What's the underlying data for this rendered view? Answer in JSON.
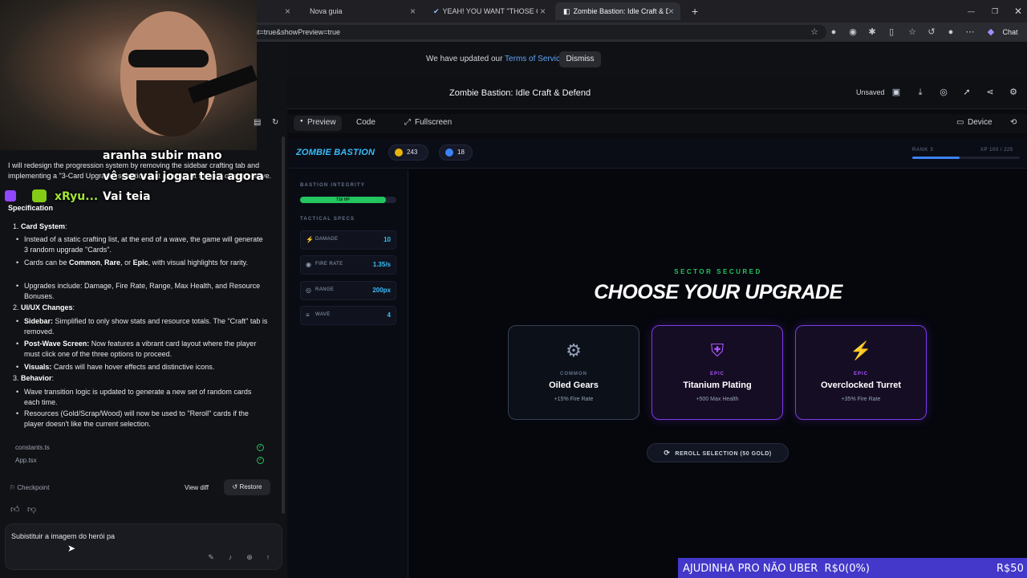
{
  "browser": {
    "tabs": [
      {
        "label": "",
        "close": "×"
      },
      {
        "label": "Nova guia",
        "close": "×"
      },
      {
        "label": "YEAH! YOU WANT \"THOSE GAMES\"",
        "close": "×"
      },
      {
        "label": "Zombie Bastion: Idle Craft & D | G",
        "close": "×"
      }
    ],
    "new_tab": "+",
    "url": "nt=true&showPreview=true",
    "chat_label": "Chat"
  },
  "notice": {
    "text": "We have updated our ",
    "link": "Terms of Service",
    "dismiss": "Dismiss"
  },
  "project": {
    "title": "Zombie Bastion: Idle Craft & Defend",
    "unsaved": "Unsaved"
  },
  "stream": {
    "captions": [
      "aranha subir mano",
      "vê se vai jogar teia agora",
      "xRyu...",
      "Vai teia"
    ]
  },
  "chat": {
    "intro": "I will redesign the progression system by removing the sidebar crafting tab and implementing a \"3-Card Upgrade\" selection that appears at the end of every wave.",
    "spec_heading": "Specification",
    "sections": [
      {
        "num": "1.",
        "title": "Card System",
        "bullets": [
          "Instead of a static crafting list, at the end of a wave, the game will generate 3 random upgrade \"Cards\".",
          "Cards can be Common, Rare, or Epic, with visual highlights for rarity.",
          "Upgrades include: Damage, Fire Rate, Range, Max Health, and Resource Bonuses."
        ]
      },
      {
        "num": "2.",
        "title": "UI/UX Changes",
        "bullets": [
          "Sidebar: Simplified to only show stats and resource totals. The \"Craft\" tab is removed.",
          "Post-Wave Screen: Now features a vibrant card layout where the player must click one of the three options to proceed.",
          "Visuals: Cards will have hover effects and distinctive icons."
        ]
      },
      {
        "num": "3.",
        "title": "Behavior",
        "bullets": [
          "Wave transition logic is updated to generate a new set of random cards each time.",
          "Resources (Gold/Scrap/Wood) will now be used to \"Reroll\" cards if the player doesn't like the current selection."
        ]
      }
    ],
    "files": [
      "constants.ts",
      "App.tsx"
    ],
    "checkpoint": "Checkpoint",
    "view_diff": "View diff",
    "restore": "Restore",
    "input_value": "Subistituir a imagem do herói pa"
  },
  "preview": {
    "tabs": [
      "Preview",
      "Code",
      "Fullscreen"
    ],
    "device": "Device"
  },
  "game": {
    "logo": "ZOMBIE BASTION",
    "gold": "243",
    "gems": "18",
    "rank": "RANK 3",
    "xp": "XP 100 / 225",
    "xp_fraction": 0.44,
    "integrity_label": "BASTION INTEGRITY",
    "hp_text": "716 HP",
    "hp_fraction": 0.89,
    "specs_label": "TACTICAL SPECS",
    "stats": [
      {
        "icon": "⚡",
        "label": "DAMAGE",
        "value": "10"
      },
      {
        "icon": "◉",
        "label": "FIRE RATE",
        "value": "1.35/s"
      },
      {
        "icon": "◎",
        "label": "RANGE",
        "value": "200px"
      },
      {
        "icon": "≡",
        "label": "WAVE",
        "value": "4"
      }
    ],
    "secured": "SECTOR SECURED",
    "choose": "CHOOSE YOUR UPGRADE",
    "cards": [
      {
        "icon": "⚙",
        "rarity": "COMMON",
        "name": "Oiled Gears",
        "desc": "+15% Fire Rate",
        "icon_color": "#94a3b8",
        "rarity_color": "#64748b"
      },
      {
        "icon": "⛨",
        "rarity": "EPIC",
        "name": "Titanium Plating",
        "desc": "+500 Max Health",
        "icon_color": "#a855f7",
        "rarity_color": "#a855f7"
      },
      {
        "icon": "⚡",
        "rarity": "EPIC",
        "name": "Overclocked Turret",
        "desc": "+35% Fire Rate",
        "icon_color": "#a855f7",
        "rarity_color": "#a855f7"
      }
    ],
    "reroll": "REROLL SELECTION (50 GOLD)"
  },
  "banner": {
    "text": "AJUDINHA PRO NÃO UBER  R$0(0%)",
    "amount": "R$50"
  }
}
